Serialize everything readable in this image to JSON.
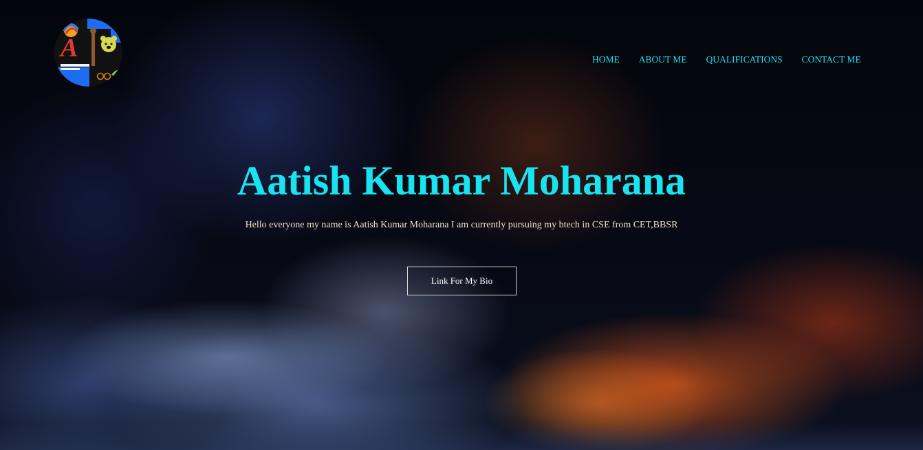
{
  "logo": {
    "letter": "A",
    "icon": "profile-logo-icon"
  },
  "nav": {
    "items": [
      {
        "label": "HOME"
      },
      {
        "label": "ABOUT ME"
      },
      {
        "label": "QUALIFICATIONS"
      },
      {
        "label": "CONTACT ME"
      }
    ]
  },
  "hero": {
    "title": "Aatish Kumar Moharana",
    "intro": "Hello everyone my name is Aatish Kumar Moharana I am currently pursuing my btech in CSE from CET,BBSR",
    "button_label": "Link For My Bio"
  },
  "colors": {
    "accent": "#19e3ee",
    "intro_text": "#f3e3c6",
    "button_text": "#ffffff"
  }
}
